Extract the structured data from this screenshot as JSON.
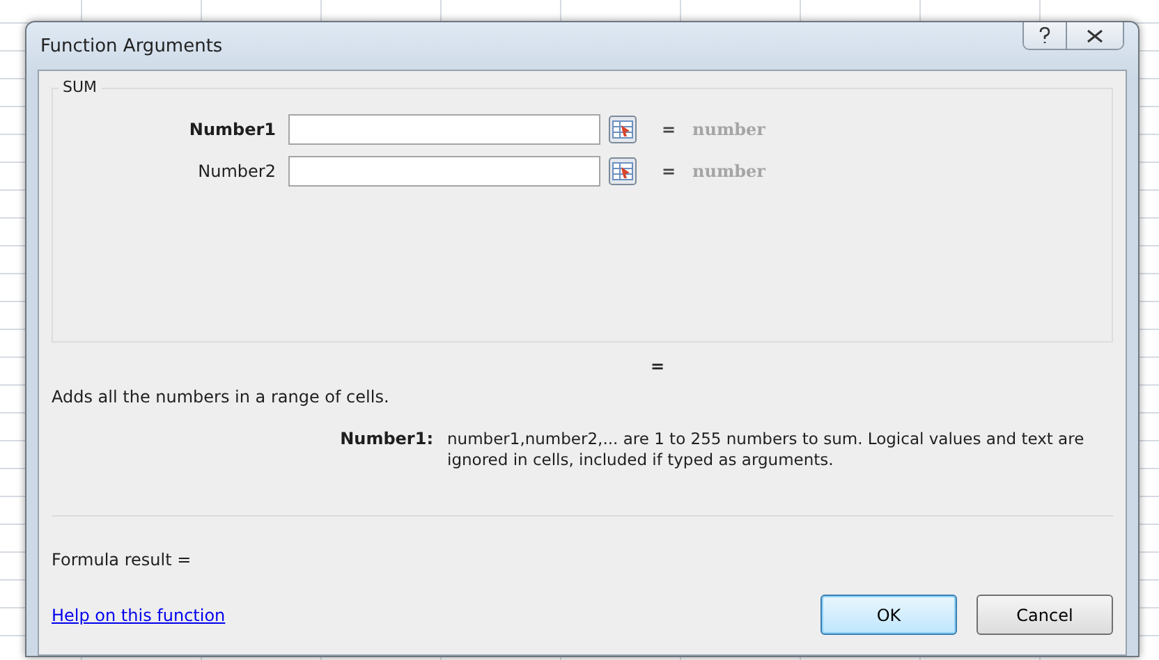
{
  "window": {
    "title": "Function Arguments"
  },
  "function": {
    "name": "SUM",
    "arguments": [
      {
        "label": "Number1",
        "required": true,
        "equals": "=",
        "result": "number"
      },
      {
        "label": "Number2",
        "required": false,
        "equals": "=",
        "result": "number"
      }
    ],
    "result_equals": "="
  },
  "description": "Adds all the numbers in a range of cells.",
  "argument_help": {
    "label": "Number1:",
    "text": "number1,number2,... are 1 to 255 numbers to sum. Logical values and text are ignored in cells, included if typed as arguments."
  },
  "formula_result": "Formula result =",
  "help_link": "Help on this function",
  "buttons": [
    {
      "label": "OK",
      "default": true
    },
    {
      "label": "Cancel",
      "default": false
    }
  ]
}
